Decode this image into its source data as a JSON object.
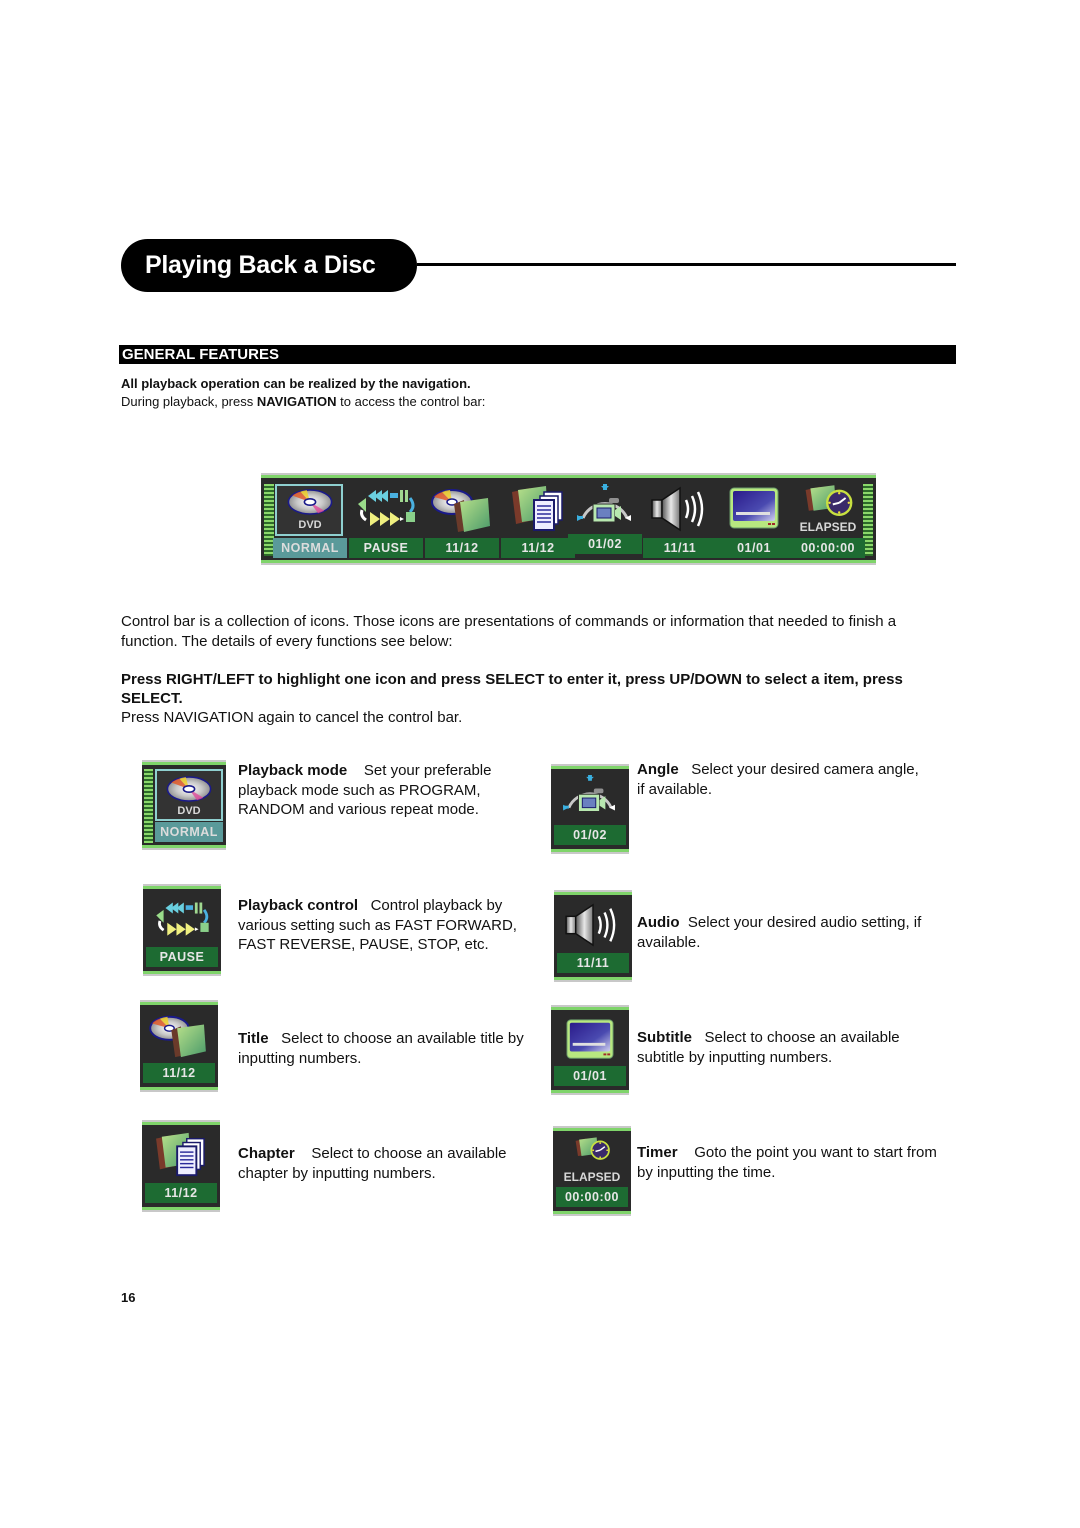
{
  "header": {
    "section_title": "Playing Back a Disc",
    "subsection_title": "GENERAL FEATURES"
  },
  "intro": {
    "bold_line": "All playback operation can be realized by the navigation.",
    "line_prefix": "During playback, press ",
    "line_key": "NAVIGATION",
    "line_suffix": " to access the control bar:"
  },
  "control_bar": {
    "items": [
      {
        "icon": "dvd-disc-icon",
        "sub": "DVD",
        "label": "NORMAL"
      },
      {
        "icon": "playback-control-icon",
        "label": "PAUSE"
      },
      {
        "icon": "title-disc-folder-icon",
        "label": "11/12"
      },
      {
        "icon": "chapter-pages-icon",
        "label": "11/12"
      },
      {
        "icon": "camera-angle-icon",
        "label": "01/02"
      },
      {
        "icon": "speaker-audio-icon",
        "label": "11/11"
      },
      {
        "icon": "subtitle-screen-icon",
        "label": "01/01"
      },
      {
        "icon": "timer-clock-icon",
        "sub": "ELAPSED",
        "label": "00:00:00"
      }
    ]
  },
  "body": {
    "paragraph1": "Control bar is a collection of icons. Those icons are presentations of commands or information that needed to finish a function. The details of every functions see below:",
    "paragraph2": "Press RIGHT/LEFT to highlight one icon and press SELECT to enter it, press UP/DOWN to select a item, press SELECT.",
    "paragraph3": "Press NAVIGATION again to cancel the control bar."
  },
  "features": {
    "playback_mode": {
      "name": "Playback mode",
      "desc": "Set your preferable playback mode such as PROGRAM, RANDOM and various repeat mode.",
      "icon_sub": "DVD",
      "icon_label": "NORMAL"
    },
    "playback_control": {
      "name": "Playback control",
      "desc": "Control playback by various setting such as  FAST FORWARD, FAST REVERSE, PAUSE, STOP, etc.",
      "icon_label": "PAUSE"
    },
    "title": {
      "name": "Title",
      "desc": "Select to choose an available title by inputting numbers.",
      "icon_label": "11/12"
    },
    "chapter": {
      "name": "Chapter",
      "desc": "Select to choose an available chapter by inputting numbers.",
      "icon_label": "11/12"
    },
    "angle": {
      "name": "Angle",
      "desc": "Select your desired camera angle, if available.",
      "icon_label": "01/02"
    },
    "audio": {
      "name": "Audio",
      "desc": "Select your desired audio setting, if available.",
      "icon_label": "11/11"
    },
    "subtitle": {
      "name": "Subtitle",
      "desc": "Select to choose an available subtitle by inputting numbers.",
      "icon_label": "01/01"
    },
    "timer": {
      "name": "Timer",
      "desc": "Goto the point you want to start from by inputting the time.",
      "icon_sub": "ELAPSED",
      "icon_label": "00:00:00"
    }
  },
  "footer": {
    "page_number": "16"
  },
  "colors": {
    "bar_frame_green": "#7fd46a",
    "label_green": "#1d6b32",
    "normal_teal": "#5a9a9a",
    "bar_bg": "#2a2a2a"
  }
}
